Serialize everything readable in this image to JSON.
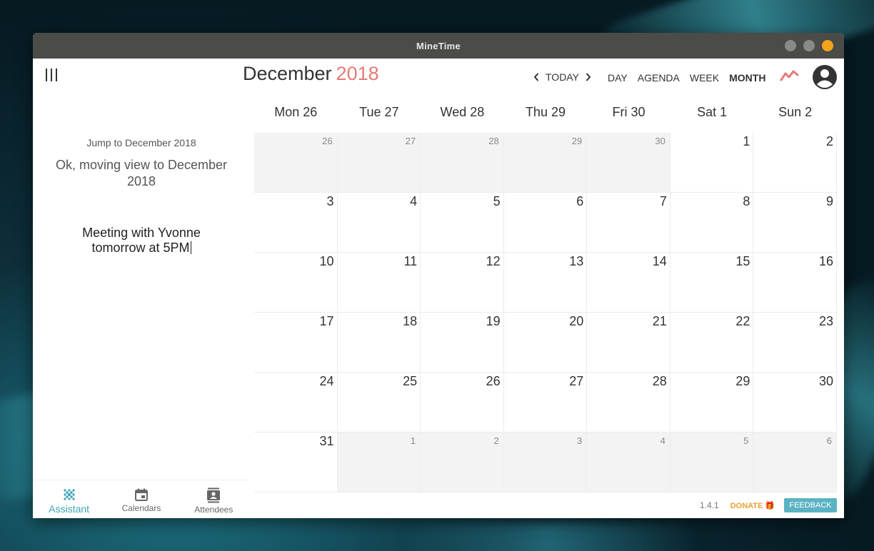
{
  "window": {
    "title": "MineTime"
  },
  "sidebar": {
    "assistant_query": "Jump to December 2018",
    "assistant_reply": "Ok, moving view to December 2018",
    "input_value": "Meeting with Yvonne tomorrow at 5PM",
    "nav": [
      {
        "label": "Assistant",
        "icon": "assistant-icon",
        "active": true
      },
      {
        "label": "Calendars",
        "icon": "calendar-icon",
        "active": false
      },
      {
        "label": "Attendees",
        "icon": "contacts-icon",
        "active": false
      }
    ]
  },
  "header": {
    "month": "December",
    "year": "2018",
    "today_label": "TODAY",
    "views": [
      "DAY",
      "AGENDA",
      "WEEK",
      "MONTH"
    ],
    "active_view": "MONTH"
  },
  "calendar": {
    "weekday_headers": [
      "Mon 26",
      "Tue 27",
      "Wed 28",
      "Thu 29",
      "Fri 30",
      "Sat 1",
      "Sun 2"
    ],
    "weeks": [
      [
        {
          "d": "26",
          "o": true
        },
        {
          "d": "27",
          "o": true
        },
        {
          "d": "28",
          "o": true
        },
        {
          "d": "29",
          "o": true
        },
        {
          "d": "30",
          "o": true
        },
        {
          "d": "1",
          "o": false
        },
        {
          "d": "2",
          "o": false
        }
      ],
      [
        {
          "d": "3",
          "o": false
        },
        {
          "d": "4",
          "o": false
        },
        {
          "d": "5",
          "o": false
        },
        {
          "d": "6",
          "o": false
        },
        {
          "d": "7",
          "o": false
        },
        {
          "d": "8",
          "o": false
        },
        {
          "d": "9",
          "o": false
        }
      ],
      [
        {
          "d": "10",
          "o": false
        },
        {
          "d": "11",
          "o": false
        },
        {
          "d": "12",
          "o": false
        },
        {
          "d": "13",
          "o": false
        },
        {
          "d": "14",
          "o": false
        },
        {
          "d": "15",
          "o": false
        },
        {
          "d": "16",
          "o": false
        }
      ],
      [
        {
          "d": "17",
          "o": false
        },
        {
          "d": "18",
          "o": false
        },
        {
          "d": "19",
          "o": false
        },
        {
          "d": "20",
          "o": false
        },
        {
          "d": "21",
          "o": false
        },
        {
          "d": "22",
          "o": false
        },
        {
          "d": "23",
          "o": false
        }
      ],
      [
        {
          "d": "24",
          "o": false
        },
        {
          "d": "25",
          "o": false
        },
        {
          "d": "26",
          "o": false
        },
        {
          "d": "27",
          "o": false
        },
        {
          "d": "28",
          "o": false
        },
        {
          "d": "29",
          "o": false
        },
        {
          "d": "30",
          "o": false
        }
      ],
      [
        {
          "d": "31",
          "o": false
        },
        {
          "d": "1",
          "o": true
        },
        {
          "d": "2",
          "o": true
        },
        {
          "d": "3",
          "o": true
        },
        {
          "d": "4",
          "o": true
        },
        {
          "d": "5",
          "o": true
        },
        {
          "d": "6",
          "o": true
        }
      ]
    ]
  },
  "footer": {
    "version": "1.4.1",
    "donate_label": "DONATE 🎁",
    "feedback_label": "FEEDBACK"
  },
  "colors": {
    "accent": "#3aa3b8",
    "year": "#e57b79",
    "close_button": "#f5a31a",
    "donate": "#e9a23a",
    "feedback_bg": "#5ab3c2"
  }
}
